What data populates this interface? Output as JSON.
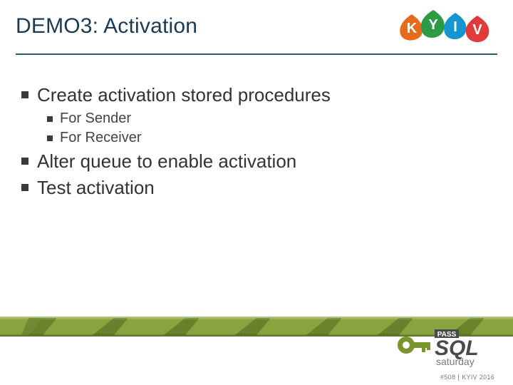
{
  "header": {
    "title": "DEMO3: Activation"
  },
  "logo_kyiv": {
    "letters": [
      "K",
      "Y",
      "I",
      "V"
    ]
  },
  "content": {
    "bullets": [
      {
        "text": "Create activation stored procedures",
        "children": [
          {
            "text": "For Sender"
          },
          {
            "text": "For Receiver"
          }
        ]
      },
      {
        "text": "Alter queue to enable activation",
        "children": []
      },
      {
        "text": "Test activation",
        "children": []
      }
    ]
  },
  "sql_logo": {
    "topword": "PASS",
    "main": "SQL",
    "sub": "saturday"
  },
  "footnote": {
    "left": "#508",
    "right": "KYIV 2016"
  },
  "colors": {
    "kyiv_k": "#e86b1c",
    "kyiv_y": "#2d9a46",
    "kyiv_i": "#1596d1",
    "kyiv_v": "#e03a3a",
    "band_olive": "#7a942e",
    "band_dark": "#5b752a",
    "sql_gray": "#5a5a5a",
    "sql_sub": "#7a7a7a",
    "key_green": "#7a942e"
  }
}
